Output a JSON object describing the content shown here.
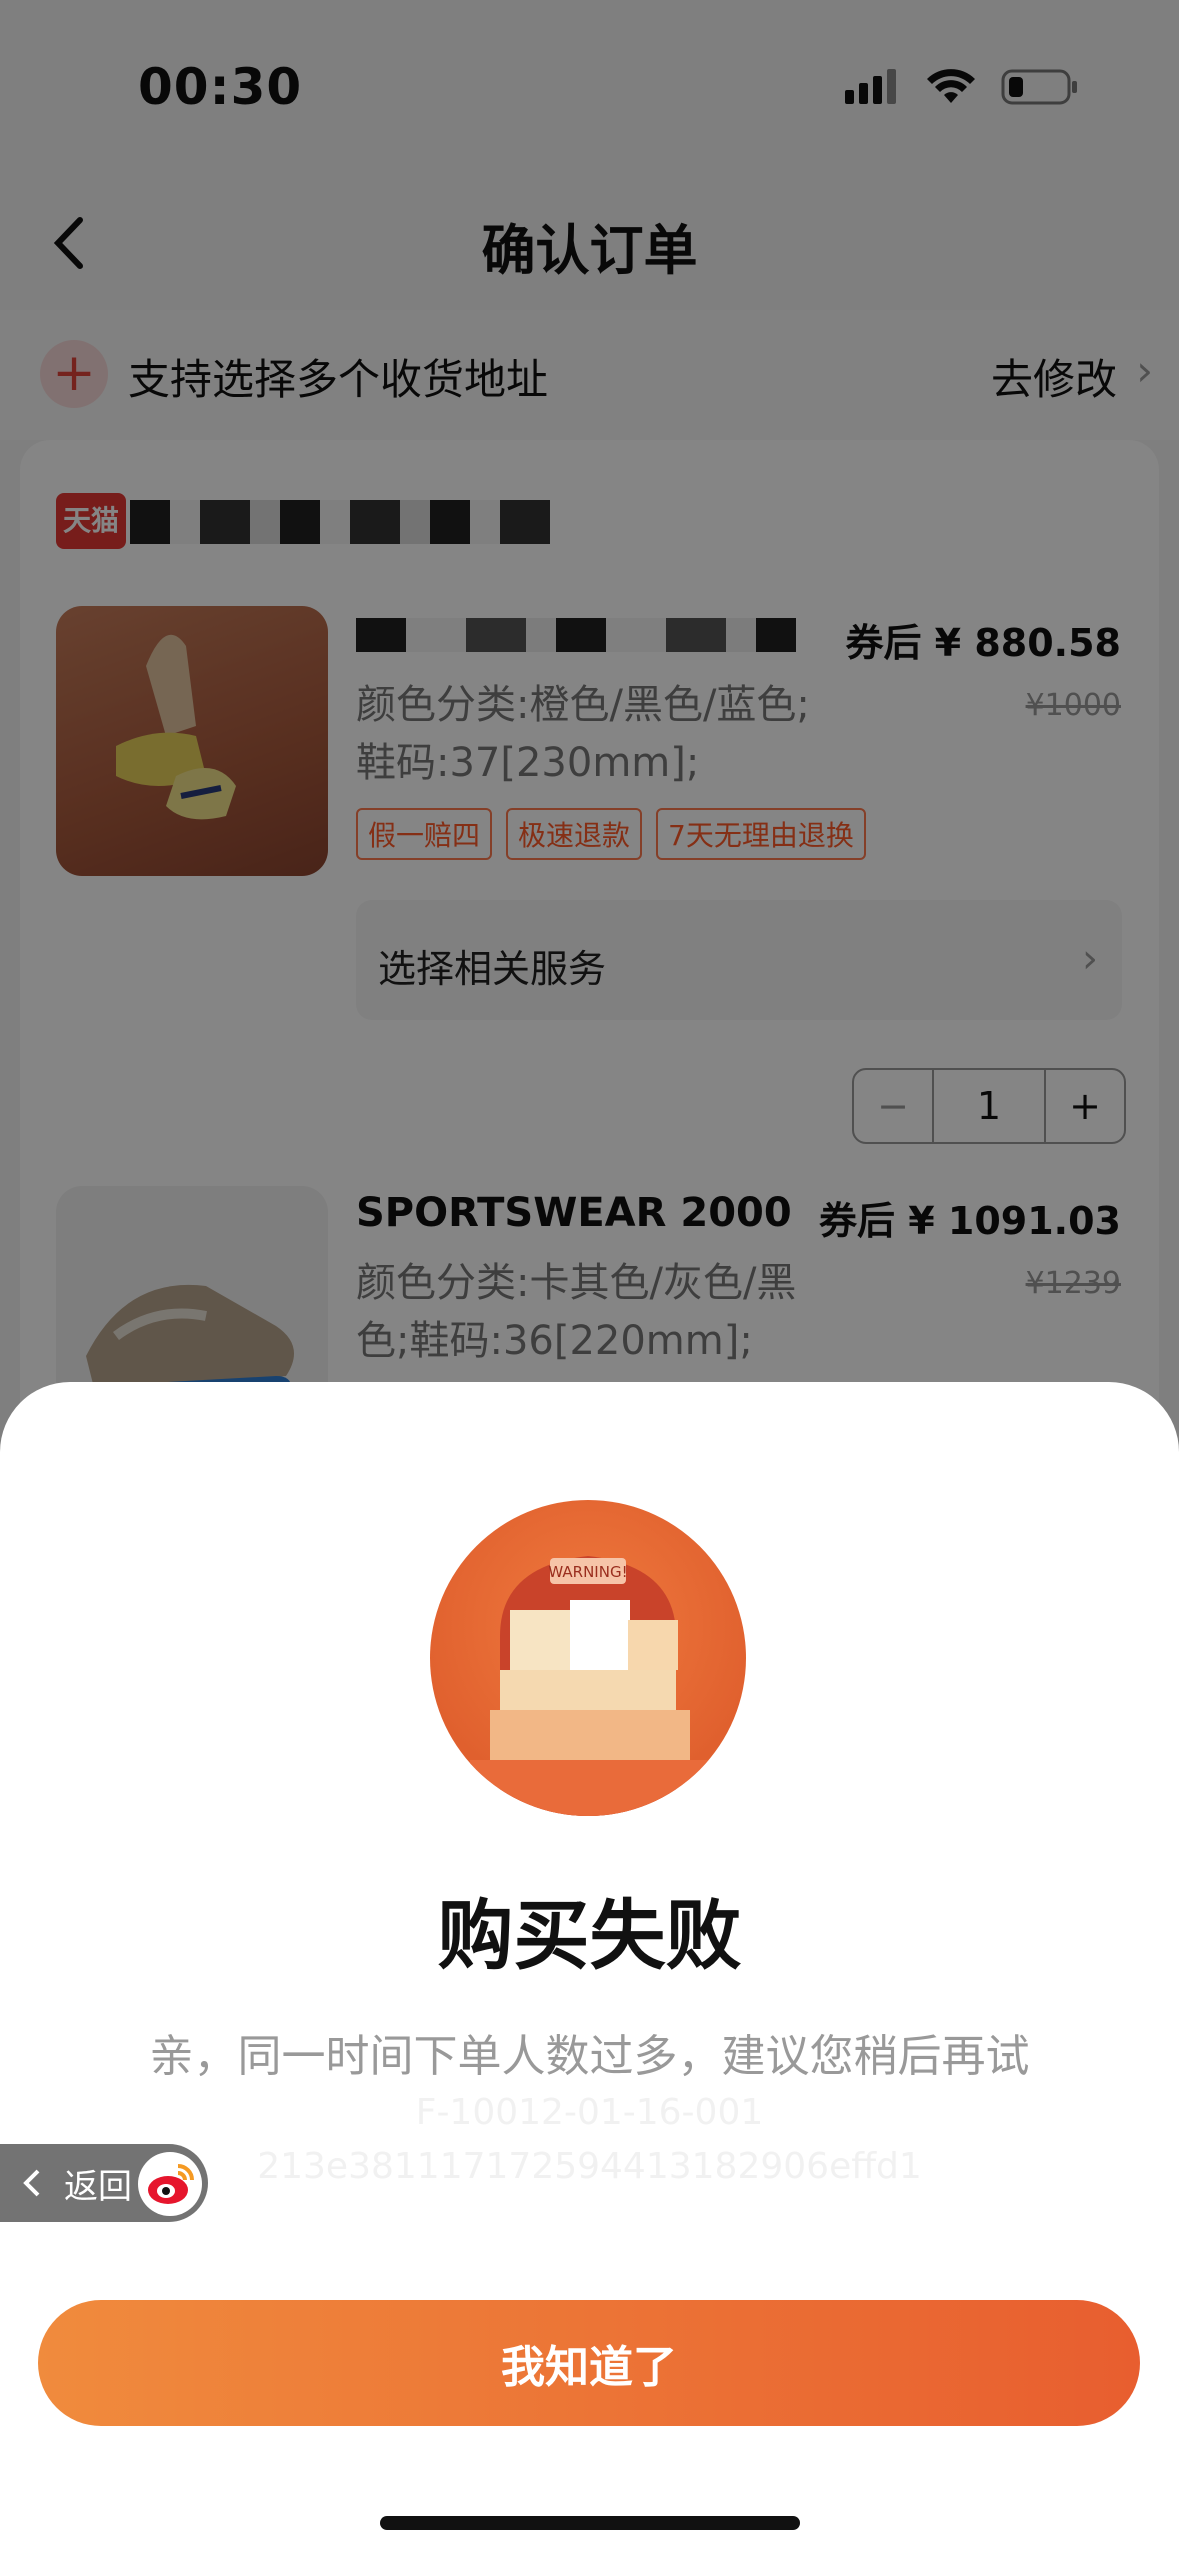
{
  "status_bar": {
    "time": "00:30"
  },
  "header": {
    "title": "确认订单"
  },
  "address_bar": {
    "text": "支持选择多个收货地址",
    "edit_label": "去修改"
  },
  "store": {
    "logo_text": "天猫"
  },
  "items": [
    {
      "price": "券后 ¥ 880.58",
      "original_price": "¥1000",
      "sku_line1": "颜色分类:橙色/黑色/蓝色;",
      "sku_line2": "鞋码:37[230mm];",
      "tags": [
        "假一赔四",
        "极速退款",
        "7天无理由退换"
      ],
      "service_label": "选择相关服务",
      "quantity": "1"
    },
    {
      "name": "SPORTSWEAR 2000",
      "price": "券后 ¥ 1091.03",
      "original_price": "¥1239",
      "sku_line1": "颜色分类:卡其色/灰色/黑",
      "sku_line2": "色;鞋码:36[220mm];"
    }
  ],
  "dialog": {
    "image_label": "WARNING!",
    "title": "购买失败",
    "message": "亲，同一时间下单人数过多，建议您稍后再试",
    "error_code": "F-10012-01-16-001",
    "trace_id": "213e381117172594413182906effd1",
    "button_label": "我知道了"
  },
  "return_pill": {
    "label": "返回"
  },
  "colors": {
    "accent": "#e85e2f",
    "button_start": "#f08b3d",
    "tag": "#ff5a2a"
  }
}
